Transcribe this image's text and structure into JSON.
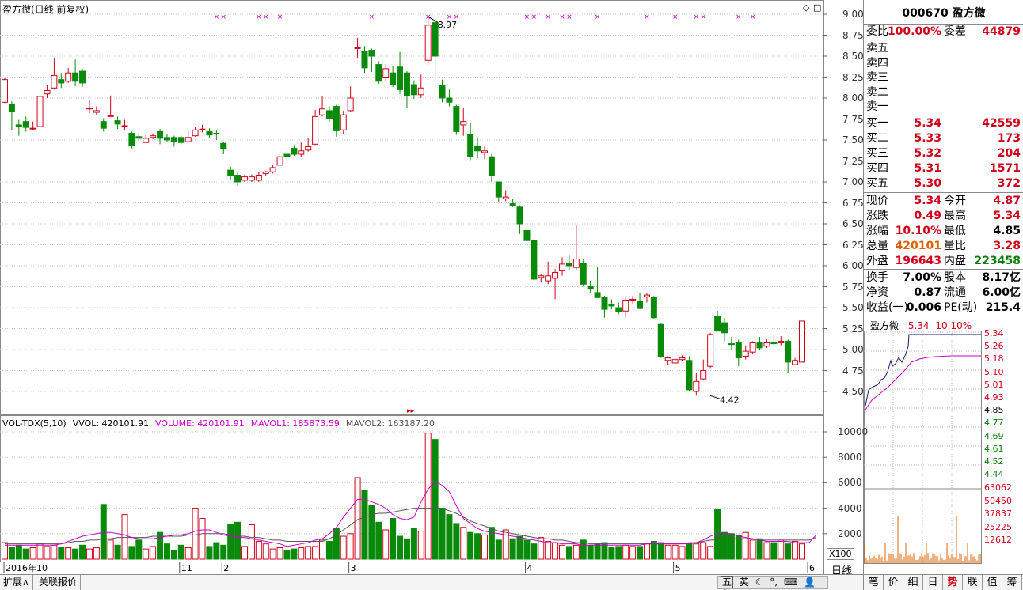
{
  "chart_title": "盈方微(日线 前复权)",
  "price_axis": [
    "9.00",
    "8.75",
    "8.50",
    "8.25",
    "8.00",
    "7.75",
    "7.50",
    "7.25",
    "7.00",
    "6.75",
    "6.50",
    "6.25",
    "6.00",
    "5.75",
    "5.50",
    "5.25",
    "5.00",
    "4.75",
    "4.50"
  ],
  "vol_axis": [
    "10000",
    "8000",
    "6000",
    "4000",
    "2000"
  ],
  "vol_unit": "X100",
  "x_ticks": [
    "2016年10",
    "11",
    "2",
    "3",
    "4",
    "5",
    "6"
  ],
  "annot_high": "8.97",
  "annot_low": "4.42",
  "volume_legend": {
    "name": "VOL-TDX(5,10)",
    "vvol": "VVOL: 420101.91",
    "volume": "VOLUME: 420101.91",
    "mavol1": "MAVOL1: 185873.59",
    "mavol2": "MAVOL2: 163187.20"
  },
  "period_label": "日线",
  "bottom_tabs": [
    "扩展∧",
    "关联报价"
  ],
  "ime_icons": [
    "五",
    "英"
  ],
  "quote": {
    "code_name": "000670 盈方微",
    "weibi_label": "委比",
    "weibi": "100.00%",
    "weicha_label": "委差",
    "weicha": "44879",
    "sell": [
      {
        "label": "卖五"
      },
      {
        "label": "卖四"
      },
      {
        "label": "卖三"
      },
      {
        "label": "卖二"
      },
      {
        "label": "卖一"
      }
    ],
    "buy": [
      {
        "label": "买一",
        "price": "5.34",
        "vol": "42559"
      },
      {
        "label": "买二",
        "price": "5.33",
        "vol": "173"
      },
      {
        "label": "买三",
        "price": "5.32",
        "vol": "204"
      },
      {
        "label": "买四",
        "price": "5.31",
        "vol": "1571"
      },
      {
        "label": "买五",
        "price": "5.30",
        "vol": "372"
      }
    ],
    "stats": [
      {
        "l1": "现价",
        "v1": "5.34",
        "l2": "今开",
        "v2": "4.87"
      },
      {
        "l1": "涨跌",
        "v1": "0.49",
        "l2": "最高",
        "v2": "5.34"
      },
      {
        "l1": "涨幅",
        "v1": "10.10%",
        "l2": "最低",
        "v2": "4.85"
      },
      {
        "l1": "总量",
        "v1": "420101",
        "l2": "量比",
        "v2": "3.28"
      },
      {
        "l1": "外盘",
        "v1": "196643",
        "l2": "内盘",
        "v2": "223458"
      }
    ],
    "stats2": [
      {
        "l1": "换手",
        "v1": "7.00%",
        "l2": "股本",
        "v2": "8.17亿"
      },
      {
        "l1": "净资",
        "v1": "0.87",
        "l2": "流通",
        "v2": "6.00亿"
      },
      {
        "l1": "收益(一)",
        "v1": "0.006",
        "l2": "PE(动)",
        "v2": "215.4"
      }
    ]
  },
  "mini_chart": {
    "name": "盈方微",
    "price": "5.34",
    "pct": "10.10%",
    "y_labels": [
      "5.34",
      "5.26",
      "5.18",
      "5.10",
      "5.01",
      "4.93",
      "4.85",
      "4.77",
      "4.69",
      "4.61",
      "4.52",
      "4.44"
    ],
    "vol_labels": [
      "63062",
      "50450",
      "37837",
      "25225",
      "12612"
    ]
  },
  "right_tabs": [
    "笔",
    "价",
    "细",
    "日",
    "势",
    "联",
    "值",
    "筹"
  ],
  "colors": {
    "up": "#d0021b",
    "down": "#0a8a0a",
    "ma1": "#cc00cc",
    "ma2": "#555555",
    "grid": "#c8c8c8"
  },
  "chart_data": {
    "type": "candlestick",
    "candles": [
      [
        7.95,
        8.22,
        8.24,
        7.94
      ],
      [
        7.92,
        7.84,
        7.96,
        7.62
      ],
      [
        7.68,
        7.66,
        7.74,
        7.55
      ],
      [
        7.72,
        7.65,
        7.78,
        7.6
      ],
      [
        7.64,
        7.64,
        7.72,
        7.62
      ],
      [
        7.66,
        8.02,
        8.05,
        7.65
      ],
      [
        8.05,
        8.09,
        8.16,
        8.0
      ],
      [
        8.12,
        8.27,
        8.48,
        8.1
      ],
      [
        8.22,
        8.18,
        8.3,
        8.12
      ],
      [
        8.2,
        8.3,
        8.36,
        8.18
      ],
      [
        8.3,
        8.2,
        8.46,
        8.14
      ],
      [
        8.32,
        8.18,
        8.35,
        8.13
      ],
      [
        7.88,
        7.88,
        7.98,
        7.82
      ],
      [
        7.83,
        7.85,
        7.9,
        7.8
      ],
      [
        7.72,
        7.64,
        7.76,
        7.6
      ],
      [
        7.78,
        7.79,
        8.03,
        7.78
      ],
      [
        7.73,
        7.69,
        7.78,
        7.63
      ],
      [
        7.67,
        7.67,
        7.74,
        7.62
      ],
      [
        7.58,
        7.43,
        7.6,
        7.4
      ],
      [
        7.54,
        7.52,
        7.57,
        7.47
      ],
      [
        7.47,
        7.52,
        7.57,
        7.47
      ],
      [
        7.53,
        7.55,
        7.58,
        7.51
      ],
      [
        7.6,
        7.52,
        7.63,
        7.45
      ],
      [
        7.53,
        7.5,
        7.57,
        7.48
      ],
      [
        7.53,
        7.48,
        7.55,
        7.42
      ],
      [
        7.53,
        7.47,
        7.55,
        7.45
      ],
      [
        7.48,
        7.53,
        7.62,
        7.46
      ],
      [
        7.55,
        7.62,
        7.66,
        7.54
      ],
      [
        7.62,
        7.63,
        7.68,
        7.59
      ],
      [
        7.6,
        7.56,
        7.64,
        7.53
      ],
      [
        7.58,
        7.57,
        7.62,
        7.5
      ],
      [
        7.46,
        7.39,
        7.48,
        7.33
      ],
      [
        7.14,
        7.08,
        7.18,
        7.03
      ],
      [
        7.08,
        7.0,
        7.12,
        6.96
      ],
      [
        7.02,
        7.06,
        7.09,
        7.0
      ],
      [
        7.02,
        7.06,
        7.09,
        7.0
      ],
      [
        7.02,
        7.08,
        7.12,
        7.0
      ],
      [
        7.1,
        7.12,
        7.13,
        7.07
      ],
      [
        7.12,
        7.17,
        7.2,
        7.1
      ],
      [
        7.2,
        7.3,
        7.38,
        7.18
      ],
      [
        7.33,
        7.3,
        7.38,
        7.22
      ],
      [
        7.4,
        7.33,
        7.44,
        7.31
      ],
      [
        7.33,
        7.37,
        7.47,
        7.3
      ],
      [
        7.38,
        7.42,
        7.52,
        7.36
      ],
      [
        7.45,
        7.78,
        7.86,
        7.44
      ],
      [
        7.8,
        7.87,
        8.02,
        7.78
      ],
      [
        7.85,
        7.75,
        7.9,
        7.72
      ],
      [
        7.9,
        7.61,
        7.92,
        7.54
      ],
      [
        7.62,
        7.8,
        7.85,
        7.57
      ],
      [
        7.85,
        8.0,
        8.14,
        7.84
      ],
      [
        8.6,
        8.6,
        8.72,
        8.48
      ],
      [
        8.56,
        8.36,
        8.62,
        8.3
      ],
      [
        8.57,
        8.5,
        8.59,
        8.31
      ],
      [
        8.4,
        8.2,
        8.44,
        8.17
      ],
      [
        8.25,
        8.35,
        8.4,
        8.2
      ],
      [
        8.3,
        8.16,
        8.38,
        8.13
      ],
      [
        8.37,
        8.1,
        8.55,
        8.05
      ],
      [
        8.3,
        8.03,
        8.32,
        7.88
      ],
      [
        8.16,
        8.04,
        8.21,
        7.99
      ],
      [
        8.04,
        8.12,
        8.28,
        8.0
      ],
      [
        8.45,
        8.87,
        8.97,
        8.4
      ],
      [
        8.9,
        8.5,
        8.92,
        8.2
      ],
      [
        8.15,
        8.0,
        8.22,
        7.95
      ],
      [
        8.0,
        7.95,
        8.1,
        7.9
      ],
      [
        7.9,
        7.6,
        7.92,
        7.56
      ],
      [
        7.68,
        7.72,
        7.88,
        7.55
      ],
      [
        7.57,
        7.3,
        7.7,
        7.26
      ],
      [
        7.43,
        7.37,
        7.53,
        7.28
      ],
      [
        7.35,
        7.37,
        7.42,
        7.27
      ],
      [
        7.3,
        7.08,
        7.33,
        7.0
      ],
      [
        7.0,
        6.82,
        7.0,
        6.76
      ],
      [
        6.8,
        6.82,
        6.9,
        6.77
      ],
      [
        6.74,
        6.72,
        6.8,
        6.7
      ],
      [
        6.7,
        6.5,
        6.72,
        6.38
      ],
      [
        6.42,
        6.3,
        6.45,
        6.24
      ],
      [
        6.3,
        5.84,
        6.32,
        5.82
      ],
      [
        5.86,
        5.88,
        5.9,
        5.8
      ],
      [
        5.82,
        5.88,
        6.05,
        5.78
      ],
      [
        5.85,
        5.92,
        5.96,
        5.6
      ],
      [
        5.94,
        6.02,
        6.1,
        5.88
      ],
      [
        6.03,
        6.0,
        6.12,
        5.95
      ],
      [
        5.98,
        6.08,
        6.48,
        5.95
      ],
      [
        6.03,
        5.78,
        6.08,
        5.75
      ],
      [
        5.76,
        5.72,
        5.82,
        5.68
      ],
      [
        5.68,
        5.62,
        5.98,
        5.65
      ],
      [
        5.62,
        5.48,
        5.64,
        5.38
      ],
      [
        5.54,
        5.52,
        5.6,
        5.48
      ],
      [
        5.5,
        5.45,
        5.56,
        5.42
      ],
      [
        5.46,
        5.59,
        5.62,
        5.38
      ],
      [
        5.6,
        5.6,
        5.64,
        5.55
      ],
      [
        5.58,
        5.49,
        5.68,
        5.48
      ],
      [
        5.63,
        5.65,
        5.68,
        5.56
      ],
      [
        5.62,
        5.38,
        5.64,
        5.37
      ],
      [
        5.3,
        4.92,
        5.31,
        4.9
      ],
      [
        4.87,
        4.9,
        4.92,
        4.82
      ],
      [
        4.84,
        4.88,
        4.9,
        4.82
      ],
      [
        4.88,
        4.9,
        4.93,
        4.86
      ],
      [
        4.87,
        4.52,
        4.92,
        4.5
      ],
      [
        4.5,
        4.62,
        4.72,
        4.45
      ],
      [
        4.65,
        4.75,
        4.88,
        4.63
      ],
      [
        4.8,
        5.18,
        5.2,
        4.78
      ],
      [
        5.4,
        5.22,
        5.46,
        5.22
      ],
      [
        5.32,
        5.2,
        5.38,
        5.1
      ],
      [
        5.07,
        5.06,
        5.15,
        5.0
      ],
      [
        5.08,
        4.9,
        5.12,
        4.8
      ],
      [
        4.92,
        4.98,
        5.05,
        4.88
      ],
      [
        4.97,
        5.08,
        5.1,
        4.95
      ],
      [
        5.08,
        5.02,
        5.15,
        5.0
      ],
      [
        5.04,
        5.08,
        5.12,
        5.02
      ],
      [
        5.08,
        5.07,
        5.18,
        5.05
      ],
      [
        5.08,
        5.1,
        5.16,
        5.05
      ],
      [
        5.1,
        4.85,
        5.12,
        4.72
      ],
      [
        4.82,
        4.87,
        4.9,
        4.82
      ],
      [
        4.85,
        5.34,
        5.34,
        4.85
      ]
    ],
    "volumes": [
      1300,
      900,
      1100,
      800,
      900,
      1200,
      1000,
      1100,
      900,
      900,
      800,
      1100,
      800,
      900,
      4300,
      1500,
      1100,
      3500,
      1000,
      1500,
      800,
      1000,
      2100,
      1200,
      700,
      1100,
      900,
      4000,
      3200,
      1000,
      1300,
      1100,
      2700,
      2900,
      1000,
      2700,
      1400,
      1200,
      800,
      900,
      700,
      800,
      900,
      1000,
      1000,
      1500,
      1400,
      2400,
      1800,
      2000,
      6400,
      5400,
      4200,
      2900,
      2300,
      3200,
      1800,
      1600,
      2400,
      2200,
      9900,
      9400,
      4000,
      3500,
      2800,
      2500,
      2100,
      2000,
      1900,
      2500,
      1500,
      2300,
      1600,
      1800,
      1500,
      1200,
      1700,
      1400,
      1300,
      1100,
      1000,
      1100,
      1500,
      1100,
      1200,
      1300,
      900,
      1000,
      1100,
      1000,
      1000,
      1200,
      1400,
      1300,
      1100,
      1100,
      1000,
      1200,
      1200,
      1300,
      1000,
      3900,
      2100,
      2000,
      1900,
      2100,
      1500,
      1600,
      1300,
      1300,
      1500,
      1200,
      1400,
      1200,
      1300,
      4200
    ],
    "mavol1": [
      1100,
      1100,
      1100,
      1100,
      1100,
      1100,
      1100,
      1100,
      1200,
      1400,
      1600,
      1800,
      1900,
      2000,
      2100,
      2100,
      2000,
      1900,
      1700,
      1600,
      1600,
      1600,
      1700,
      1800,
      1900,
      1900,
      2000,
      2200,
      2300,
      2300,
      2100,
      1900,
      1800,
      1700,
      1700,
      1600,
      1500,
      1400,
      1300,
      1200,
      1000,
      1100,
      1200,
      1300,
      1500,
      1600,
      2000,
      2500,
      3300,
      4000,
      4700,
      4700,
      4500,
      4300,
      4000,
      3500,
      3200,
      3100,
      3300,
      4500,
      5500,
      6100,
      5800,
      5300,
      4200,
      3200,
      2800,
      2400,
      2200,
      2100,
      2000,
      1900,
      1800,
      1700,
      1600,
      1500,
      1400,
      1300,
      1300,
      1200,
      1200,
      1200,
      1100,
      1100,
      1100,
      1100,
      1100,
      1100,
      1100,
      1100,
      1100,
      1200,
      1200,
      1200,
      1200,
      1200,
      1200,
      1200,
      1300,
      1500,
      1800,
      2000,
      2000,
      2000,
      1800,
      1700,
      1600,
      1500,
      1400,
      1400,
      1400,
      1400,
      1300,
      1300,
      1300,
      1900
    ],
    "mavol2": [
      1200,
      1200,
      1200,
      1200,
      1200,
      1200,
      1200,
      1200,
      1200,
      1300,
      1400,
      1400,
      1500,
      1500,
      1600,
      1600,
      1700,
      1700,
      1700,
      1700,
      1700,
      1800,
      1800,
      1800,
      1800,
      1800,
      1900,
      1900,
      2000,
      2000,
      2000,
      2000,
      1900,
      1800,
      1800,
      1700,
      1700,
      1600,
      1500,
      1500,
      1400,
      1400,
      1400,
      1400,
      1400,
      1400,
      1600,
      1900,
      2300,
      2700,
      3100,
      3300,
      3500,
      3600,
      3600,
      3700,
      3800,
      3900,
      4000,
      4000,
      4000,
      4000,
      4000,
      3800,
      3600,
      3300,
      3000,
      2800,
      2600,
      2400,
      2200,
      2100,
      2000,
      1900,
      1800,
      1700,
      1600,
      1600,
      1500,
      1500,
      1400,
      1300,
      1300,
      1200,
      1200,
      1200,
      1200,
      1200,
      1200,
      1200,
      1200,
      1200,
      1200,
      1200,
      1200,
      1200,
      1200,
      1300,
      1300,
      1400,
      1500,
      1500,
      1600,
      1600,
      1600,
      1600,
      1600,
      1500,
      1500,
      1500,
      1500,
      1500,
      1500,
      1500,
      1500,
      1700
    ]
  }
}
